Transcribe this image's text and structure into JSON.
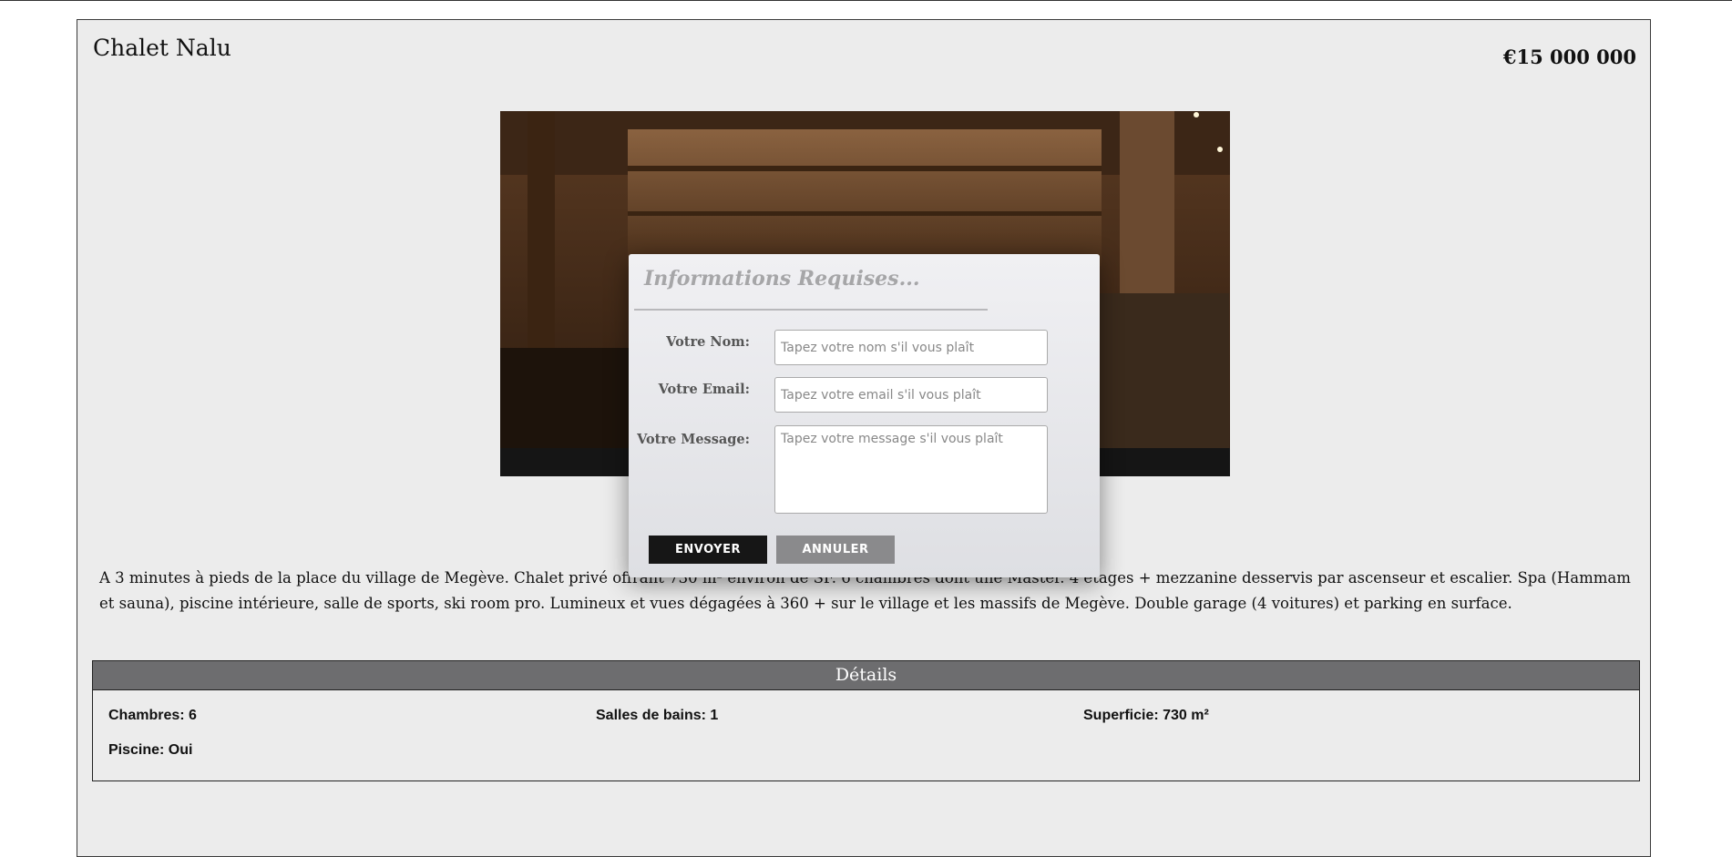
{
  "listing": {
    "title": "Chalet Nalu",
    "price": "€15 000 000",
    "description": "A 3 minutes à pieds de la place du village de Megève. Chalet privé offrant 730 m² environ de SF. 6 chambres dont une Master. 4 étages + mezzanine desservis par ascenseur et escalier. Spa (Hammam et sauna), piscine intérieure, salle de sports, ski room pro. Lumineux et vues dégagées à 360 + sur le village et les massifs de Megève. Double garage (4 voitures) et parking en surface."
  },
  "details": {
    "heading": "Détails",
    "items": [
      "Chambres: 6",
      "Salles de bains: 1",
      "Superficie: 730 m²",
      "Piscine: Oui"
    ]
  },
  "modal": {
    "title": "Informations Requises...",
    "fields": {
      "name": {
        "label": "Votre Nom:",
        "placeholder": "Tapez votre nom s'il vous plaît"
      },
      "email": {
        "label": "Votre Email:",
        "placeholder": "Tapez votre email s'il vous plaît"
      },
      "message": {
        "label": "Votre Message:",
        "placeholder": "Tapez votre message s'il vous plaît"
      }
    },
    "buttons": {
      "send": "ENVOYER",
      "cancel": "ANNULER"
    }
  },
  "colors": {
    "page_bg": "#ececec",
    "details_header": "#6d6d6f",
    "send_button": "#161616",
    "cancel_button": "#8a8a8c"
  }
}
